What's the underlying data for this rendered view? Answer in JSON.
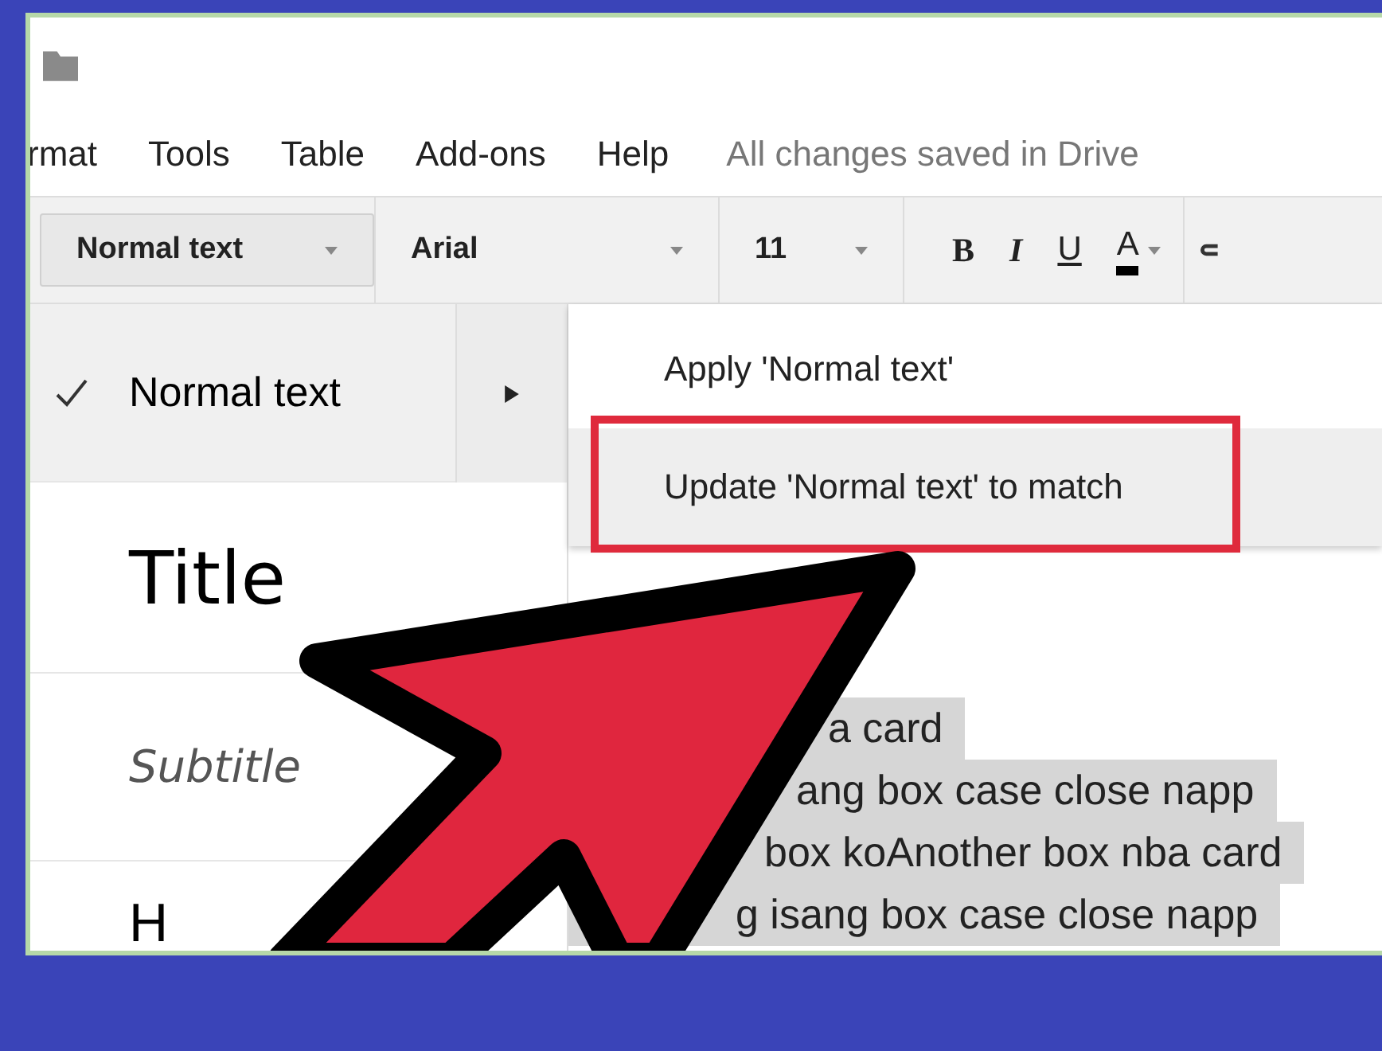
{
  "menu": [
    {
      "label": "rmat"
    },
    {
      "label": "Tools"
    },
    {
      "label": "Table"
    },
    {
      "label": "Add-ons"
    },
    {
      "label": "Help"
    }
  ],
  "save_status": "All changes saved in Drive",
  "toolbar": {
    "style": "Normal text",
    "font": "Arial",
    "size": "11",
    "buttons": [
      {
        "label": "B",
        "kind": "bold"
      },
      {
        "label": "I",
        "kind": "italic"
      },
      {
        "label": "U",
        "kind": "underline"
      },
      {
        "label": "A",
        "kind": "color"
      }
    ]
  },
  "styles": [
    {
      "label": "Normal text",
      "checked": true,
      "kind": "normal"
    },
    {
      "label": "Title",
      "checked": false,
      "kind": "title"
    },
    {
      "label": "Subtitle",
      "checked": false,
      "kind": "subtitle"
    },
    {
      "label": "H",
      "checked": false,
      "kind": "heading"
    }
  ],
  "submenu": {
    "items": [
      {
        "label": "Apply 'Normal text'",
        "selected": false
      },
      {
        "label": "Update 'Normal text' to match",
        "selected": true
      }
    ]
  },
  "document_lines": [
    {
      "text": "a card"
    },
    {
      "text": "ang box case close napp"
    },
    {
      "text": "box koAnother box nba card"
    },
    {
      "text": "g isang box case close napp"
    }
  ]
}
